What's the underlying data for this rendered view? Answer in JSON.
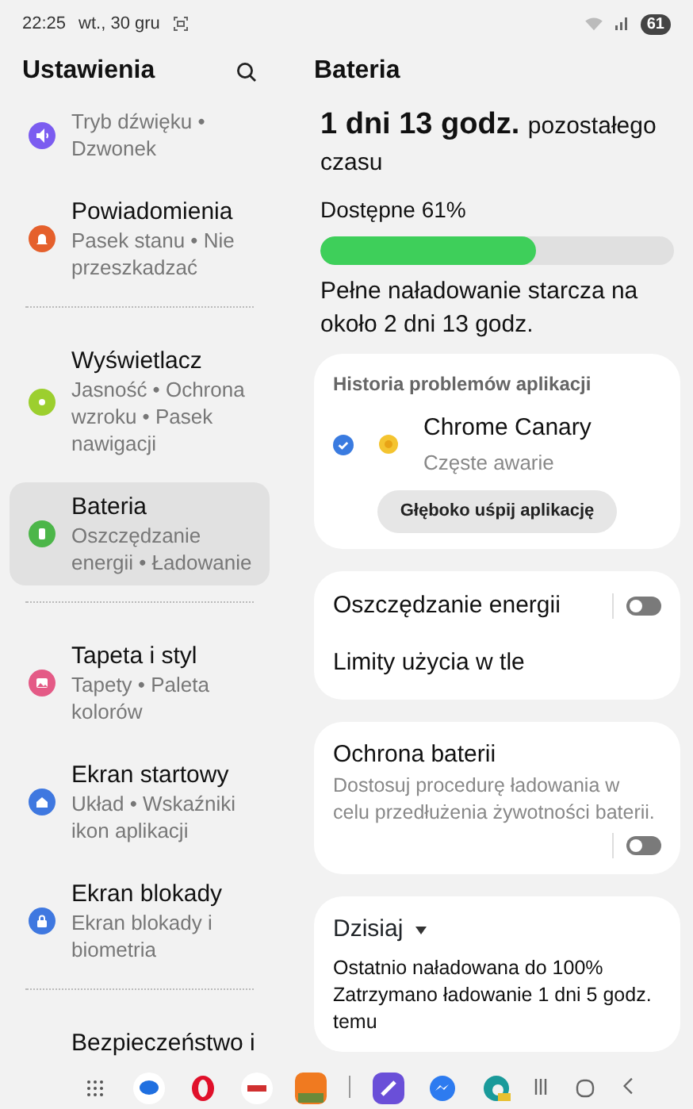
{
  "status_bar": {
    "time": "22:25",
    "date": "wt., 30 gru",
    "battery": "61"
  },
  "sidebar": {
    "title": "Ustawienia",
    "groups": [
      [
        {
          "subtitle": "Tryb dźwięku • Dzwonek",
          "color": "#7b5cf0",
          "selected": false
        },
        {
          "title": "Powiadomienia",
          "subtitle": "Pasek stanu • Nie przeszkadzać",
          "color": "#e5602c",
          "selected": false
        }
      ],
      [
        {
          "title": "Wyświetlacz",
          "subtitle": "Jasność • Ochrona wzroku • Pasek nawigacji",
          "color": "#9ccf2e",
          "selected": false
        },
        {
          "title": "Bateria",
          "subtitle": "Oszczędzanie energii • Ładowanie",
          "color": "#4cb649",
          "selected": true
        }
      ],
      [
        {
          "title": "Tapeta i styl",
          "subtitle": "Tapety • Paleta kolorów",
          "color": "#e45a86",
          "selected": false
        },
        {
          "title": "Ekran startowy",
          "subtitle": "Układ • Wskaźniki ikon aplikacji",
          "color": "#3f78e0",
          "selected": false
        },
        {
          "title": "Ekran blokady",
          "subtitle": "Ekran blokady i biometria",
          "color": "#3f78e0",
          "selected": false
        }
      ],
      [
        {
          "title": "Bezpieczeństwo i"
        }
      ]
    ]
  },
  "battery": {
    "title": "Bateria",
    "remaining": "1 dni 13 godz.",
    "remaining_suffix": "pozostałego czasu",
    "available": "Dostępne 61%",
    "level": 0.61,
    "full_charge": "Pełne naładowanie starcza na około 2 dni 13 godz.",
    "app_issues": {
      "heading": "Historia problemów aplikacji",
      "apps": [
        {
          "name": "Chrome Canary",
          "status": "Częste awarie",
          "checked": true
        }
      ],
      "button": "Głęboko uśpij aplikację"
    },
    "settings": [
      {
        "kind": "toggle",
        "label": "Oszczędzanie energii",
        "on": false
      },
      {
        "kind": "link",
        "label": "Limity użycia w tle"
      }
    ],
    "protection": {
      "title": "Ochrona baterii",
      "description": "Dostosuj procedurę ładowania w celu przedłużenia żywotności baterii.",
      "on": false
    },
    "usage": {
      "period": "Dzisiaj",
      "lines": [
        "Ostatnio naładowana do 100%",
        "Zatrzymano ładowanie 1 dni 5 godz. temu"
      ]
    }
  }
}
